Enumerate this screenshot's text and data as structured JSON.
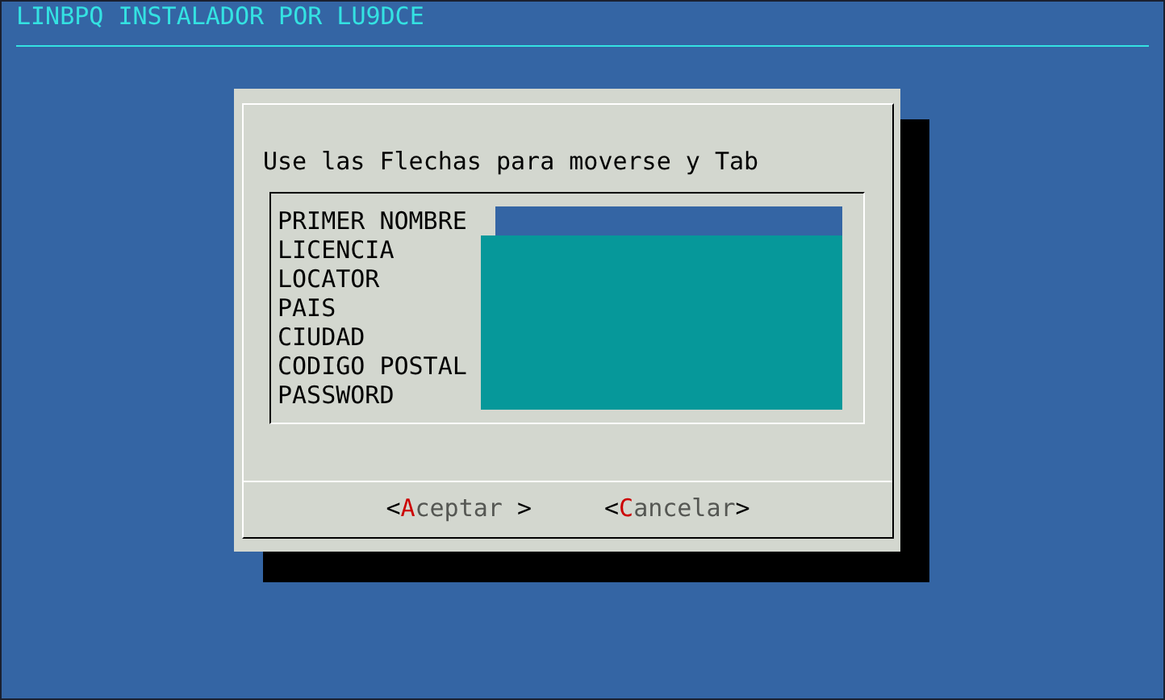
{
  "backtitle": "LINBPQ INSTALADOR POR LU9DCE",
  "dialog": {
    "prompt": "Use las Flechas para moverse y Tab",
    "fields": [
      {
        "label": "PRIMER NOMBRE",
        "selected": true
      },
      {
        "label": "LICENCIA",
        "selected": false
      },
      {
        "label": "LOCATOR",
        "selected": false
      },
      {
        "label": "PAIS",
        "selected": false
      },
      {
        "label": "CIUDAD",
        "selected": false
      },
      {
        "label": "CODIGO POSTAL",
        "selected": false
      },
      {
        "label": "PASSWORD",
        "selected": false
      }
    ],
    "buttons": [
      {
        "left": "<",
        "hotkey": "A",
        "text": "ceptar",
        "right": " >"
      },
      {
        "left": "<",
        "hotkey": "C",
        "text": "ancelar",
        "right": ">"
      }
    ]
  }
}
